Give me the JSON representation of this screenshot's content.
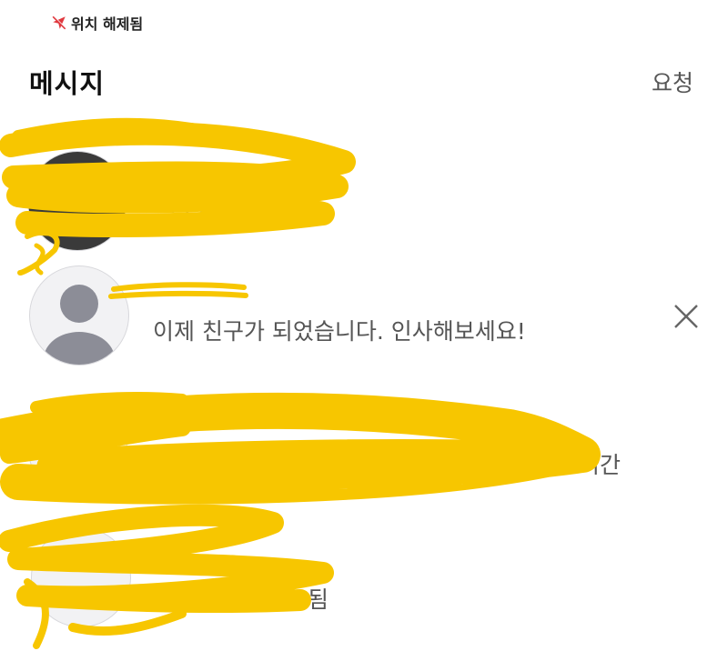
{
  "location": {
    "text": "위치 해제됨",
    "icon": "location-off-icon"
  },
  "header": {
    "title": "메시지",
    "requests_label": "요청"
  },
  "conversations": [
    {
      "redacted": true
    },
    {
      "preview": "이제 친구가 되었습니다. 인사해보세요!",
      "dismiss_icon": "close-icon"
    },
    {
      "redacted": true,
      "partial_visible_text": "시간"
    },
    {
      "redacted": true,
      "partial_visible_text": "됨"
    }
  ],
  "colors": {
    "redaction": "#f7c600",
    "avatar_fill": "#8c8d97",
    "text_secondary": "#555555"
  }
}
